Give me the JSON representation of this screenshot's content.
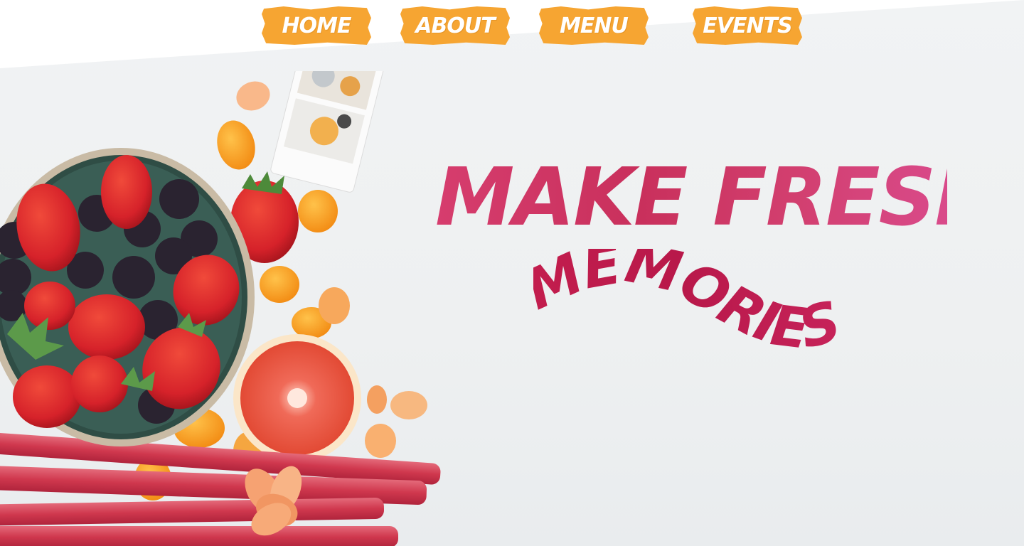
{
  "nav": {
    "items": [
      {
        "label": "HOME"
      },
      {
        "label": "ABOUT"
      },
      {
        "label": "MENU"
      },
      {
        "label": "EVENTS"
      }
    ]
  },
  "hero": {
    "headline": "MAKE FRESH",
    "subheadline": "MEMORIES"
  },
  "colors": {
    "nav_accent": "#f6a532",
    "headline": "#d63d6e",
    "subheadline": "#b8184a"
  }
}
